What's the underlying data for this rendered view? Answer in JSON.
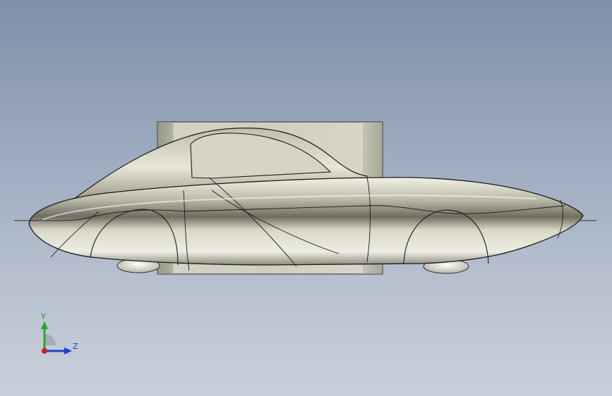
{
  "viewport": {
    "background_top": "#7f90a9",
    "background_bottom": "#c9d0db"
  },
  "model": {
    "body_color": "#d9d8c8",
    "bounding_block_color": "#c7c6b6",
    "edge_color": "#1b1b1b"
  },
  "triad": {
    "y_label": "Y",
    "z_label": "Z",
    "y_color": "#22aa22",
    "z_color": "#1f3fcc",
    "x_color": "#cc1f1f"
  }
}
